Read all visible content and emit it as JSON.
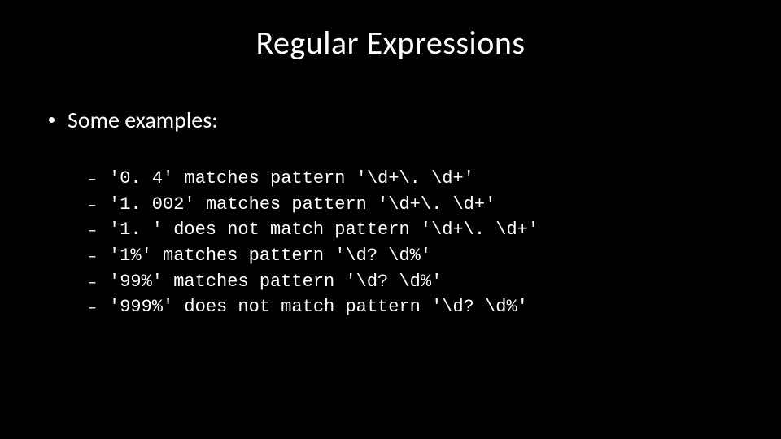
{
  "title": "Regular Expressions",
  "bullet_text": "Some examples:",
  "dash_glyph": "–",
  "examples": [
    {
      "text": "'0. 4' matches pattern '\\d+\\. \\d+'"
    },
    {
      "text": "'1. 002' matches pattern '\\d+\\. \\d+'"
    },
    {
      "text": "'1. ' does not match pattern '\\d+\\. \\d+'"
    },
    {
      "text": "'1%' matches pattern '\\d? \\d%'"
    },
    {
      "text": "'99%' matches pattern '\\d? \\d%'"
    },
    {
      "text": "'999%' does not match pattern '\\d? \\d%'"
    }
  ]
}
